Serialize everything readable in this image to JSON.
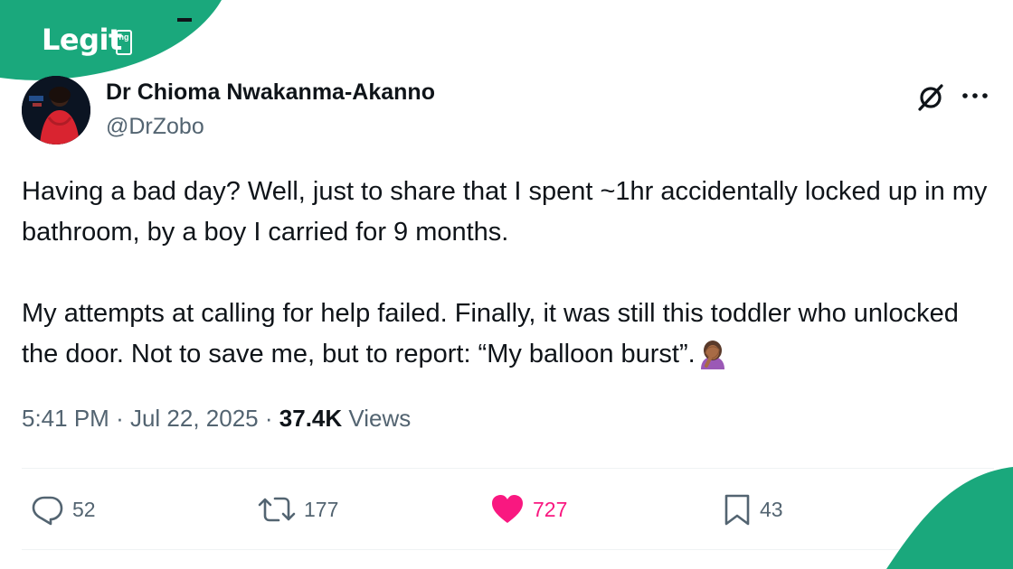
{
  "brand": {
    "logo_text": "Legit",
    "logo_tld": "ng",
    "accent": "#1aa87c"
  },
  "tweet": {
    "author_name": "Dr Chioma Nwakanma-Akanno",
    "author_handle": "@DrZobo",
    "paragraph_1": "Having a bad day? Well, just to share that I spent ~1hr accidentally locked up in my bathroom, by a boy I carried for 9 months.",
    "paragraph_2": "My attempts at calling for help failed. Finally, it was still this toddler who unlocked the door. Not to save me, but to report: “My balloon burst”.",
    "emoji": "woman-facepalming",
    "time": "5:41 PM",
    "separator": "·",
    "date": "Jul 22, 2025",
    "views_count": "37.4K",
    "views_label": "Views"
  },
  "actions": {
    "replies": "52",
    "reposts": "177",
    "likes": "727",
    "bookmarks": "43"
  },
  "colors": {
    "text": "#0f1419",
    "secondary": "#536471",
    "like": "#f91880",
    "divider": "#eff3f4"
  },
  "icons": [
    "grok-icon",
    "more-icon",
    "reply-icon",
    "repost-icon",
    "like-icon",
    "bookmark-icon"
  ]
}
